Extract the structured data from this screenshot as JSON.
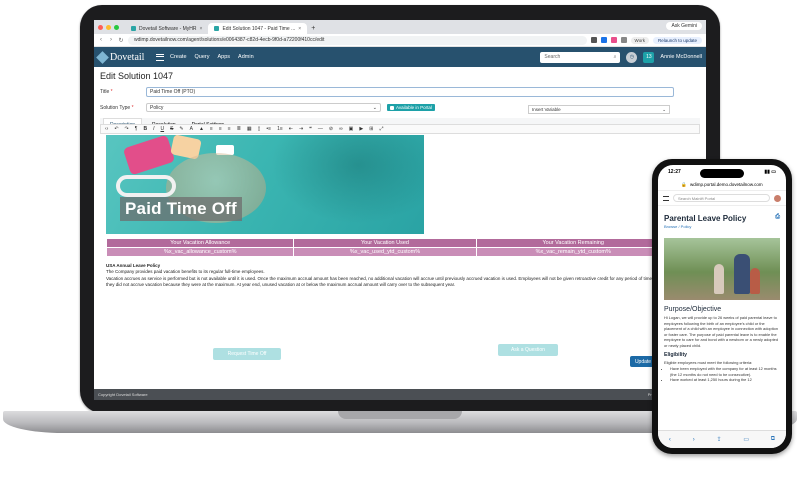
{
  "browser": {
    "tabs": [
      {
        "label": "Dovetail Software - MyHR"
      },
      {
        "label": "Edit Solution 1047 - Paid Time ..."
      }
    ],
    "ask_gemini": "Ask Gemini",
    "url": "wdimp.dovetailnow.com/agent/solutions/e0064387-c82d-4ecb-9f0d-a72200f410cc/edit",
    "work_label": "Work",
    "relaunch_label": "Relaunch to update"
  },
  "app": {
    "logo": "Dovetail",
    "menu": [
      "Create",
      "Query",
      "Apps",
      "Admin"
    ],
    "search_placeholder": "Search",
    "notification_count": "13",
    "user_name": "Annie McDonnell"
  },
  "form": {
    "page_title": "Edit Solution 1047",
    "title_label": "Title",
    "title_value": "Paid Time Off (PTO)",
    "type_label": "Solution Type",
    "type_value": "Policy",
    "available_in_portal": "Available in Portal",
    "tabs": [
      "Description",
      "Resolution",
      "Portal Settings"
    ],
    "insert_variable": "Insert Variable",
    "hero_text": "Paid Time Off",
    "table_headers": [
      "Your Vacation Allowance",
      "Your Vacation Used",
      "Your Vacation Remaining"
    ],
    "table_values": [
      "%x_vac_allowance_custom%",
      "%x_vac_used_ytd_custom%",
      "%x_vac_remain_ytd_custom%"
    ],
    "policy_heading": "USA Annual Leave Policy",
    "policy_line1": "The Company provides paid vacation benefits to its regular full-time employees.",
    "policy_line2": "Vacation accrues as service is performed but is not available until it is used. Once the maximum accrual amount has been reached, no additional vacation will accrue until previously accrued vacation is used. Employees will not be given retroactive credit for any period of time in which they did not accrue vacation because they were at the maximum. At year end, unused vacation at or below the maximum accrual amount will carry over to the subsequent year.",
    "button_request": "Request Time Off",
    "button_question": "Ask a Question",
    "update_label": "Update",
    "footer_left": "Copyright Dovetail Software",
    "footer_right": "Press ? for keyboard shortcuts"
  },
  "phone": {
    "time": "12:27",
    "url": "wdimp.portal.demo.dovetailnow.com",
    "search_placeholder": "Search Mainlft Portal",
    "title": "Parental Leave Policy",
    "crumb": "Browse / Policy",
    "section_heading": "Purpose/Objective",
    "section_text": "Hi Logan, we will provide up to 26 weeks of paid parental leave to employees following the birth of an employee's child or the placement of a child with an employee in connection with adoption or foster care. The purpose of paid parental leave is to enable the employee to care for and bond with a newborn or a newly adopted or newly placed child.",
    "eligibility_heading": "Eligibility",
    "eligibility_text": "Eligible employees must meet the following criteria:",
    "bullet1": "Have been employed with the company for at least 12 months (the 12 months do not need to be consecutive).",
    "bullet2": "Have worked at least 1,250 hours during the 12"
  },
  "colors": {
    "app_header": "#27516e",
    "accent_teal": "#1da1a8",
    "table_header": "#b26a9b",
    "update_button": "#1c6aa6"
  }
}
